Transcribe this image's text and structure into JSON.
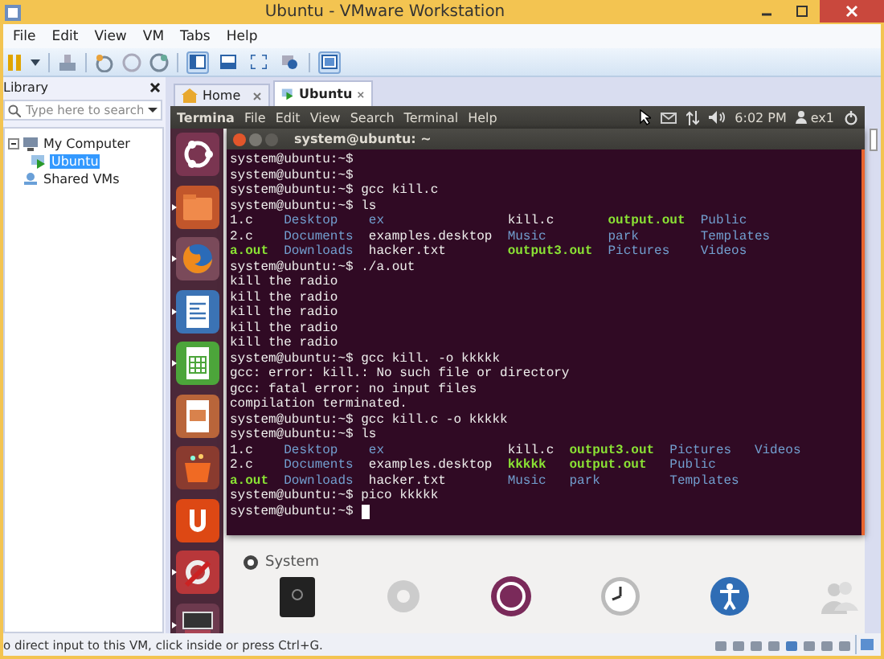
{
  "window": {
    "title": "Ubuntu - VMware Workstation"
  },
  "menu": [
    "File",
    "Edit",
    "View",
    "VM",
    "Tabs",
    "Help"
  ],
  "library": {
    "title": "Library",
    "search": {
      "placeholder": "Type here to search"
    },
    "tree": [
      {
        "label": "My Computer",
        "kind": "computer",
        "expanded": true,
        "selected": false,
        "children": [
          {
            "label": "Ubuntu",
            "kind": "vm",
            "selected": true
          }
        ]
      },
      {
        "label": "Shared VMs",
        "kind": "shared",
        "selected": false
      }
    ]
  },
  "tabs": [
    {
      "label": "Home",
      "kind": "home",
      "selected": false
    },
    {
      "label": "Ubuntu",
      "kind": "vm",
      "selected": true
    }
  ],
  "guest": {
    "panel": {
      "app": "Termina",
      "menu": [
        "File",
        "Edit",
        "View",
        "Search",
        "Terminal",
        "Help"
      ],
      "clock": "6:02 PM",
      "user": "ex1"
    },
    "launcher": [
      {
        "kind": "dash",
        "running": false
      },
      {
        "kind": "files",
        "running": true
      },
      {
        "kind": "firefox",
        "running": true
      },
      {
        "kind": "writer",
        "running": true
      },
      {
        "kind": "calc",
        "running": true
      },
      {
        "kind": "impress",
        "running": false
      },
      {
        "kind": "store",
        "running": false
      },
      {
        "kind": "ubuntu-one",
        "running": false
      },
      {
        "kind": "settings",
        "running": true
      },
      {
        "kind": "workspaces",
        "running": true
      }
    ],
    "terminal": {
      "title": "system@ubuntu: ~",
      "lines": [
        {
          "kind": "text",
          "text": "system@ubuntu:~$"
        },
        {
          "kind": "text",
          "text": "system@ubuntu:~$"
        },
        {
          "kind": "text",
          "text": "system@ubuntu:~$ gcc kill.c"
        },
        {
          "kind": "text",
          "text": "system@ubuntu:~$ ls"
        },
        {
          "kind": "listing",
          "rows": [
            [
              {
                "name": "1.c",
                "kind": "file"
              },
              {
                "name": "Desktop",
                "kind": "dir"
              },
              {
                "name": "ex",
                "kind": "dir"
              },
              {
                "name": "kill.c",
                "kind": "file"
              },
              {
                "name": "output.out",
                "kind": "exec"
              },
              {
                "name": "Public",
                "kind": "dir"
              }
            ],
            [
              {
                "name": "2.c",
                "kind": "file"
              },
              {
                "name": "Documents",
                "kind": "dir"
              },
              {
                "name": "examples.desktop",
                "kind": "file"
              },
              {
                "name": "Music",
                "kind": "dir"
              },
              {
                "name": "park",
                "kind": "dir"
              },
              {
                "name": "Templates",
                "kind": "dir"
              }
            ],
            [
              {
                "name": "a.out",
                "kind": "exec"
              },
              {
                "name": "Downloads",
                "kind": "dir"
              },
              {
                "name": "hacker.txt",
                "kind": "file"
              },
              {
                "name": "output3.out",
                "kind": "exec"
              },
              {
                "name": "Pictures",
                "kind": "dir"
              },
              {
                "name": "Videos",
                "kind": "dir"
              }
            ]
          ]
        },
        {
          "kind": "text",
          "text": "system@ubuntu:~$ ./a.out"
        },
        {
          "kind": "text",
          "text": "kill the radio"
        },
        {
          "kind": "text",
          "text": "kill the radio"
        },
        {
          "kind": "text",
          "text": "kill the radio"
        },
        {
          "kind": "text",
          "text": "kill the radio"
        },
        {
          "kind": "text",
          "text": "kill the radio"
        },
        {
          "kind": "text",
          "text": "system@ubuntu:~$ gcc kill. -o kkkkk"
        },
        {
          "kind": "text",
          "text": "gcc: error: kill.: No such file or directory"
        },
        {
          "kind": "text",
          "text": "gcc: fatal error: no input files"
        },
        {
          "kind": "text",
          "text": "compilation terminated."
        },
        {
          "kind": "text",
          "text": "system@ubuntu:~$ gcc kill.c -o kkkkk"
        },
        {
          "kind": "text",
          "text": "system@ubuntu:~$ ls"
        },
        {
          "kind": "listing",
          "rows": [
            [
              {
                "name": "1.c",
                "kind": "file"
              },
              {
                "name": "Desktop",
                "kind": "dir"
              },
              {
                "name": "ex",
                "kind": "dir"
              },
              {
                "name": "kill.c",
                "kind": "file"
              },
              {
                "name": "output3.out",
                "kind": "exec"
              },
              {
                "name": "Pictures",
                "kind": "dir"
              },
              {
                "name": "Videos",
                "kind": "dir"
              }
            ],
            [
              {
                "name": "2.c",
                "kind": "file"
              },
              {
                "name": "Documents",
                "kind": "dir"
              },
              {
                "name": "examples.desktop",
                "kind": "file"
              },
              {
                "name": "kkkkk",
                "kind": "exec"
              },
              {
                "name": "output.out",
                "kind": "exec"
              },
              {
                "name": "Public",
                "kind": "dir"
              }
            ],
            [
              {
                "name": "a.out",
                "kind": "exec"
              },
              {
                "name": "Downloads",
                "kind": "dir"
              },
              {
                "name": "hacker.txt",
                "kind": "file"
              },
              {
                "name": "Music",
                "kind": "dir"
              },
              {
                "name": "park",
                "kind": "dir"
              },
              {
                "name": "Templates",
                "kind": "dir"
              }
            ]
          ]
        },
        {
          "kind": "text",
          "text": "system@ubuntu:~$ pico kkkkk"
        },
        {
          "kind": "input",
          "text": "system@ubuntu:~$",
          "cursor": true
        }
      ]
    },
    "system": {
      "title": "System",
      "items": [
        {
          "kind": "backup"
        },
        {
          "kind": "details"
        },
        {
          "kind": "management"
        },
        {
          "kind": "clock"
        },
        {
          "kind": "access"
        },
        {
          "kind": "users"
        }
      ]
    }
  },
  "status_bar": {
    "text": "o direct input to this VM, click inside or press Ctrl+G."
  }
}
